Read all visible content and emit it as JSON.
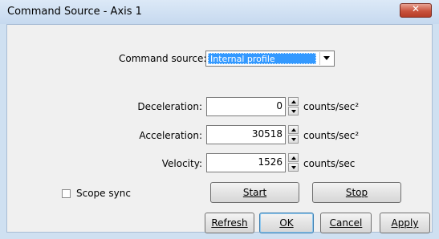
{
  "window": {
    "title": "Command Source - Axis 1",
    "close_glyph": "✕"
  },
  "command_source": {
    "label": "Command source:",
    "value": "Internal profile"
  },
  "fields": [
    {
      "label": "Deceleration:",
      "value": "0",
      "unit": "counts/sec²"
    },
    {
      "label": "Acceleration:",
      "value": "30518",
      "unit": "counts/sec²"
    },
    {
      "label": "Velocity:",
      "value": "1526",
      "unit": "counts/sec"
    }
  ],
  "scope_sync": {
    "label": "Scope sync",
    "checked": false
  },
  "buttons": {
    "start": "Start",
    "stop": "Stop",
    "refresh": "Refresh",
    "ok": "OK",
    "cancel": "Cancel",
    "apply": "Apply"
  },
  "colors": {
    "title_bg": "#c6d9ef",
    "close_red": "#c9523c",
    "selection": "#3399ff"
  }
}
